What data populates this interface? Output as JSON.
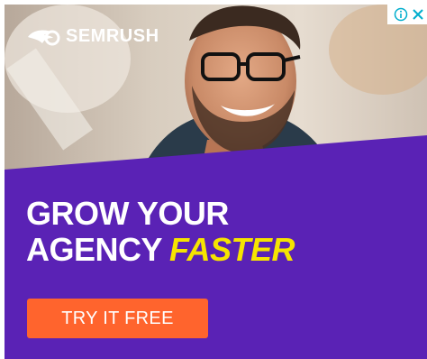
{
  "ad": {
    "brand": "SEMRUSH",
    "headline_line1": "GROW YOUR",
    "headline_line2": "AGENCY",
    "headline_accent": "FASTER",
    "cta_label": "TRY IT FREE"
  },
  "colors": {
    "purple": "#5a22b5",
    "orange": "#ff642d",
    "yellow": "#f6e400",
    "adchoices_blue": "#00aecd"
  },
  "icons": {
    "logo": "semrush-flame-icon",
    "info": "info-icon",
    "close": "close-icon"
  }
}
